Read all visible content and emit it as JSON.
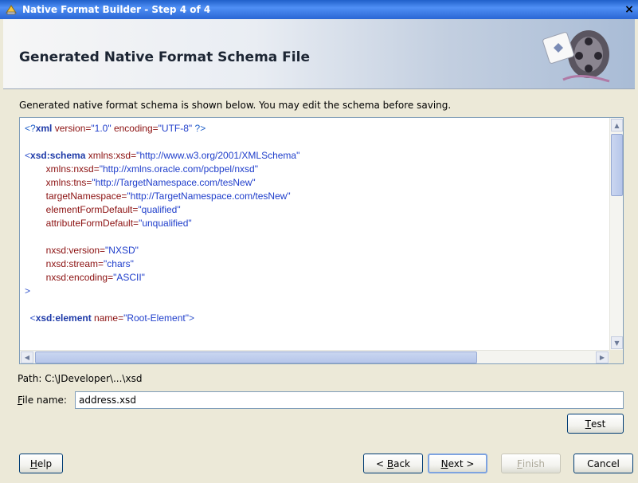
{
  "window": {
    "title": "Native Format Builder - Step 4 of 4",
    "close_glyph": "×"
  },
  "header": {
    "title": "Generated Native Format Schema File"
  },
  "description": "Generated native format schema is shown below. You may edit the schema before saving.",
  "editor": {
    "lines": [
      [
        {
          "t": "<?",
          "c": "pi"
        },
        {
          "t": "xml",
          "c": "tag"
        },
        {
          "t": " version=",
          "c": "attr"
        },
        {
          "t": "\"1.0\"",
          "c": "val"
        },
        {
          "t": " encoding=",
          "c": "attr"
        },
        {
          "t": "\"UTF-8\"",
          "c": "val"
        },
        {
          "t": " ?>",
          "c": "pi"
        }
      ],
      [],
      [
        {
          "t": "<",
          "c": "punct"
        },
        {
          "t": "xsd:schema",
          "c": "tag"
        },
        {
          "t": " xmlns:xsd=",
          "c": "attr"
        },
        {
          "t": "\"http://www.w3.org/2001/XMLSchema\"",
          "c": "val"
        }
      ],
      [
        {
          "t": "        xmlns:nxsd=",
          "c": "attr"
        },
        {
          "t": "\"http://xmlns.oracle.com/pcbpel/nxsd\"",
          "c": "val"
        }
      ],
      [
        {
          "t": "        xmlns:tns=",
          "c": "attr"
        },
        {
          "t": "\"http://TargetNamespace.com/tesNew\"",
          "c": "val"
        }
      ],
      [
        {
          "t": "        targetNamespace=",
          "c": "attr"
        },
        {
          "t": "\"http://TargetNamespace.com/tesNew\"",
          "c": "val"
        }
      ],
      [
        {
          "t": "        elementFormDefault=",
          "c": "attr"
        },
        {
          "t": "\"qualified\"",
          "c": "val"
        }
      ],
      [
        {
          "t": "        attributeFormDefault=",
          "c": "attr"
        },
        {
          "t": "\"unqualified\"",
          "c": "val"
        }
      ],
      [],
      [
        {
          "t": "        nxsd:version=",
          "c": "attr"
        },
        {
          "t": "\"NXSD\"",
          "c": "val"
        }
      ],
      [
        {
          "t": "        nxsd:stream=",
          "c": "attr"
        },
        {
          "t": "\"chars\"",
          "c": "val"
        }
      ],
      [
        {
          "t": "        nxsd:encoding=",
          "c": "attr"
        },
        {
          "t": "\"ASCII\"",
          "c": "val"
        }
      ],
      [
        {
          "t": ">",
          "c": "punct"
        }
      ],
      [],
      [
        {
          "t": "  <",
          "c": "punct"
        },
        {
          "t": "xsd:element",
          "c": "tag"
        },
        {
          "t": " name=",
          "c": "attr"
        },
        {
          "t": "\"Root-Element\"",
          "c": "val"
        },
        {
          "t": ">",
          "c": "punct"
        }
      ]
    ]
  },
  "path": {
    "label": "Path: C:\\JDeveloper\\...\\xsd"
  },
  "filename": {
    "label_access_key": "F",
    "label_rest": "ile name:",
    "value": "address.xsd"
  },
  "buttons": {
    "test": {
      "key": "T",
      "rest": "est"
    },
    "help": {
      "key": "H",
      "rest": "elp"
    },
    "back": {
      "prefix": "< ",
      "key": "B",
      "rest": "ack"
    },
    "next": {
      "key": "N",
      "rest": "ext >"
    },
    "finish": {
      "key": "F",
      "rest": "inish"
    },
    "cancel": {
      "label": "Cancel"
    }
  }
}
